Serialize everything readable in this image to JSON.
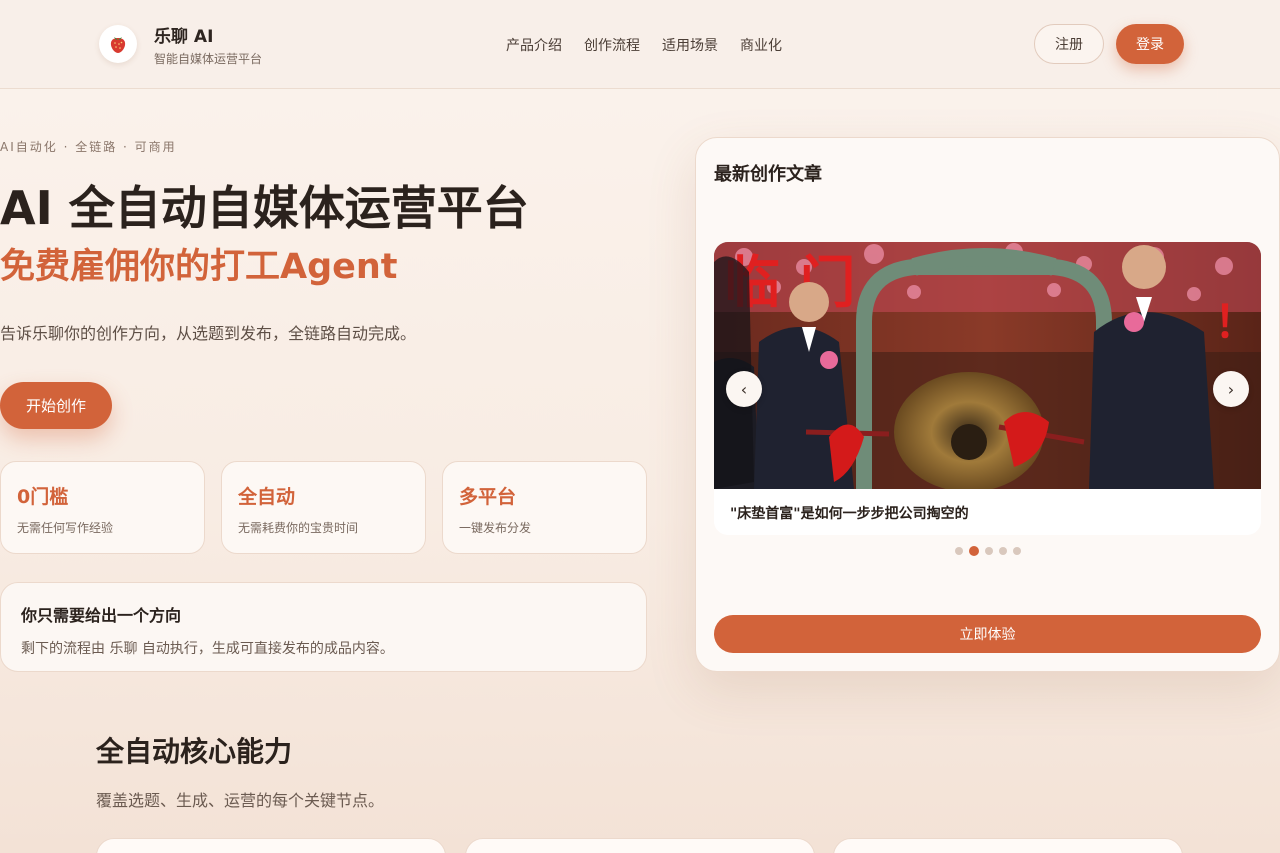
{
  "header": {
    "brand_name": "乐聊 AI",
    "brand_sub": "智能自媒体运营平台",
    "logo_icon": "strawberry-icon",
    "nav": [
      "产品介绍",
      "创作流程",
      "适用场景",
      "商业化"
    ],
    "register_label": "注册",
    "login_label": "登录"
  },
  "hero": {
    "eyebrow": "AI自动化 · 全链路 · 可商用",
    "title": "AI 全自动自媒体运营平台",
    "subtitle": "免费雇佣你的打工Agent",
    "description": "告诉乐聊你的创作方向，从选题到发布，全链路自动完成。",
    "start_label": "开始创作",
    "features": [
      {
        "title": "0门槛",
        "desc": "无需任何写作经验"
      },
      {
        "title": "全自动",
        "desc": "无需耗费你的宝贵时间"
      },
      {
        "title": "多平台",
        "desc": "一键发布分发"
      }
    ],
    "direction": {
      "title": "你只需要给出一个方向",
      "desc": "剩下的流程由 乐聊 自动执行，生成可直接发布的成品内容。"
    }
  },
  "panel": {
    "title": "最新创作文章",
    "caption": "\"床垫首富\"是如何一步步把公司掏空的",
    "dots_total": 5,
    "active_dot": 2,
    "try_label": "立即体验"
  },
  "core": {
    "title": "全自动核心能力",
    "subtitle": "覆盖选题、生成、运营的每个关键节点。"
  },
  "colors": {
    "accent": "#d2633a",
    "background": "#f8ece3"
  }
}
